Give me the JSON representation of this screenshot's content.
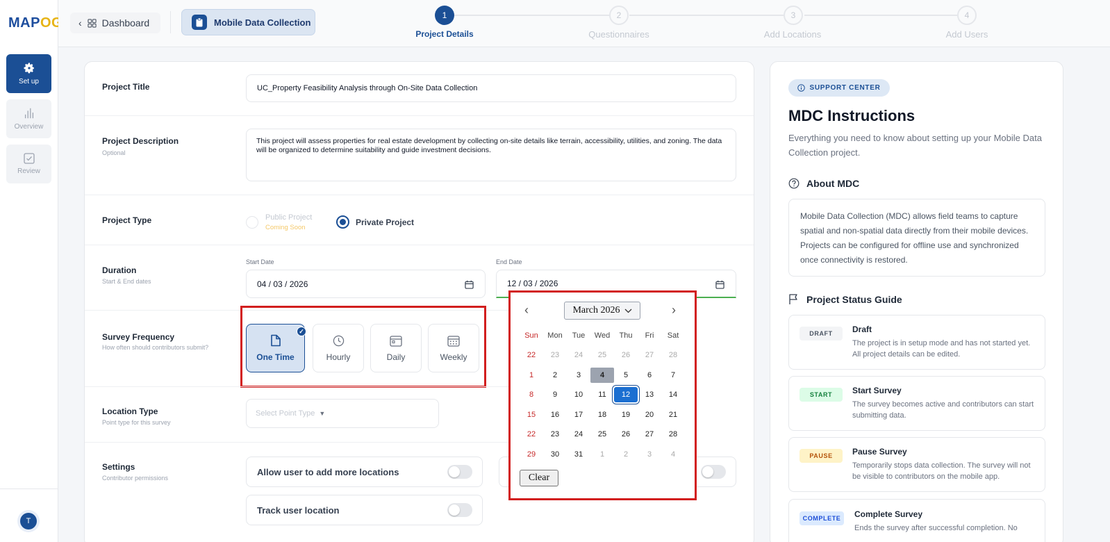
{
  "app": {
    "logo_main": "MAP",
    "logo_accent": "OG"
  },
  "sidebar": {
    "items": [
      {
        "label": "Set up",
        "icon": "gear-icon",
        "active": true
      },
      {
        "label": "Overview",
        "icon": "bar-chart-icon",
        "active": false
      },
      {
        "label": "Review",
        "icon": "checkbox-icon",
        "active": false
      }
    ],
    "avatar_initial": "T"
  },
  "header": {
    "back_label": "Dashboard",
    "project_chip": "Mobile Data Collection",
    "steps": [
      {
        "num": "1",
        "label": "Project Details",
        "active": true
      },
      {
        "num": "2",
        "label": "Questionnaires",
        "active": false
      },
      {
        "num": "3",
        "label": "Add Locations",
        "active": false
      },
      {
        "num": "4",
        "label": "Add Users",
        "active": false
      }
    ]
  },
  "form": {
    "title": {
      "label": "Project Title",
      "value": "UC_Property Feasibility Analysis through On-Site Data Collection"
    },
    "description": {
      "label": "Project Description",
      "sub": "Optional",
      "value": "This project will assess properties for real estate development by collecting on-site details like terrain, accessibility, utilities, and zoning. The data will be organized to determine suitability and guide investment decisions."
    },
    "type": {
      "label": "Project Type",
      "public_label": "Public Project",
      "public_sub": "Coming Soon",
      "private_label": "Private Project",
      "selected": "private"
    },
    "duration": {
      "label": "Duration",
      "sub": "Start & End dates",
      "start_label": "Start Date",
      "start_value": "04 / 03 / 2026",
      "end_label": "End Date",
      "end_value": "12 / 03 / 2026"
    },
    "frequency": {
      "label": "Survey Frequency",
      "sub": "How often should contributors submit?",
      "options": [
        "One Time",
        "Hourly",
        "Daily",
        "Weekly"
      ],
      "selected": "One Time"
    },
    "location": {
      "label": "Location Type",
      "sub": "Point type for this survey",
      "placeholder": "Select Point Type"
    },
    "settings": {
      "label": "Settings",
      "sub": "Contributor permissions",
      "toggles": [
        {
          "label": "Allow user to add more locations",
          "on": false
        },
        {
          "label": "Track user location",
          "on": false
        }
      ]
    }
  },
  "calendar": {
    "month_label": "March 2026",
    "weekdays": [
      "Sun",
      "Mon",
      "Tue",
      "Wed",
      "Thu",
      "Fri",
      "Sat"
    ],
    "weeks": [
      [
        "22",
        "23",
        "24",
        "25",
        "26",
        "27",
        "28"
      ],
      [
        "1",
        "2",
        "3",
        "4",
        "5",
        "6",
        "7"
      ],
      [
        "8",
        "9",
        "10",
        "11",
        "12",
        "13",
        "14"
      ],
      [
        "15",
        "16",
        "17",
        "18",
        "19",
        "20",
        "21"
      ],
      [
        "22",
        "23",
        "24",
        "25",
        "26",
        "27",
        "28"
      ],
      [
        "29",
        "30",
        "31",
        "1",
        "2",
        "3",
        "4"
      ]
    ],
    "today": "4",
    "selected": "12",
    "clear_label": "Clear"
  },
  "support": {
    "pill": "SUPPORT CENTER",
    "title": "MDC Instructions",
    "desc": "Everything you need to know about setting up your Mobile Data Collection project.",
    "about_title": "About MDC",
    "about_text": "Mobile Data Collection (MDC) allows field teams to capture spatial and non-spatial data directly from their mobile devices. Projects can be configured for offline use and synchronized once connectivity is restored.",
    "status_title": "Project Status Guide",
    "statuses": [
      {
        "badge": "DRAFT",
        "title": "Draft",
        "desc": "The project is in setup mode and has not started yet. All project details can be edited.",
        "bg": "#f3f4f6",
        "fg": "#4b5563"
      },
      {
        "badge": "START",
        "title": "Start Survey",
        "desc": "The survey becomes active and contributors can start submitting data.",
        "bg": "#dcfce7",
        "fg": "#15803d"
      },
      {
        "badge": "PAUSE",
        "title": "Pause Survey",
        "desc": "Temporarily stops data collection. The survey will not be visible to contributors on the mobile app.",
        "bg": "#fef3c7",
        "fg": "#b45309"
      },
      {
        "badge": "COMPLETE",
        "title": "Complete Survey",
        "desc": "Ends the survey after successful completion. No",
        "bg": "#dbeafe",
        "fg": "#1d4ed8"
      }
    ]
  }
}
